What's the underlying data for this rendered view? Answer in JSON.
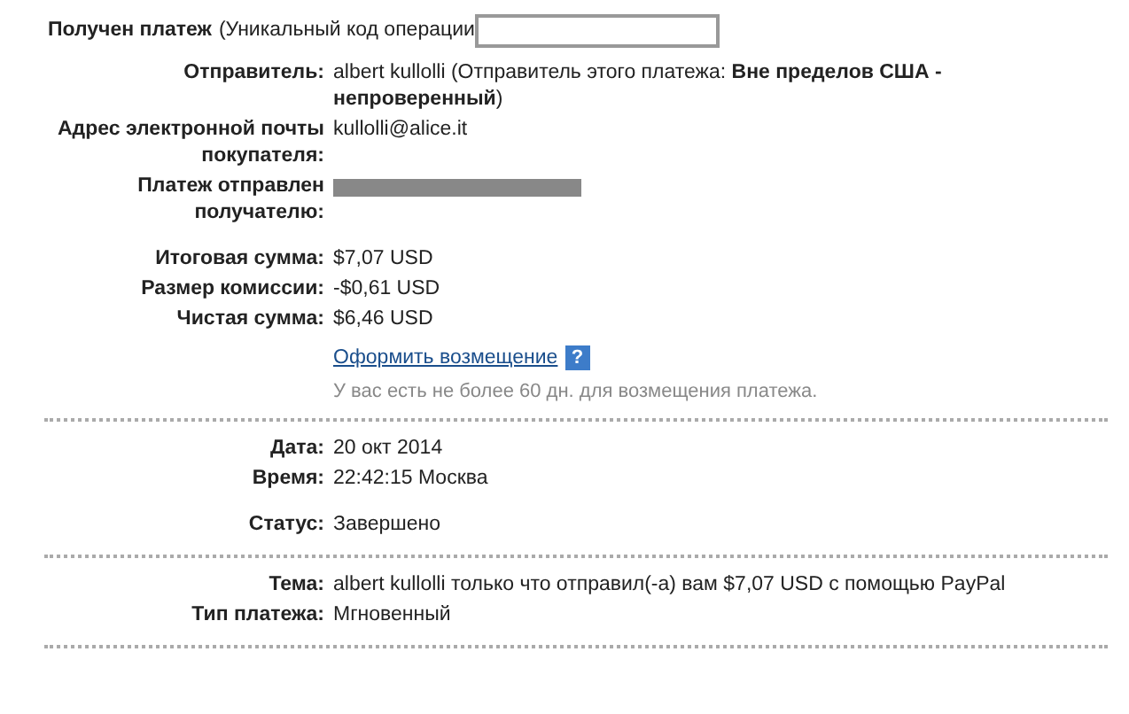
{
  "header": {
    "title": "Получен платеж",
    "text": "(Уникальный код операции",
    "code_redacted": true
  },
  "sections": [
    {
      "groups": [
        [
          {
            "kind": "text",
            "label": "Отправитель:",
            "value": "albert kullolli (Отправитель этого платежа: **Вне пределов США - непроверенный**)"
          },
          {
            "kind": "text",
            "label": "Адрес электронной почты покупателя:",
            "value": "kullolli@alice.it"
          },
          {
            "kind": "redacted",
            "label": "Платеж отправлен получателю:"
          }
        ],
        [
          {
            "kind": "text",
            "label": "Итоговая сумма:",
            "value": "$7,07 USD"
          },
          {
            "kind": "text",
            "label": "Размер комиссии:",
            "value": "-$0,61 USD"
          },
          {
            "kind": "text",
            "label": "Чистая сумма:",
            "value": "$6,46 USD"
          }
        ]
      ],
      "refund": {
        "link": "Оформить возмещение",
        "help": "?",
        "note": "У вас есть не более 60 дн. для возмещения платежа."
      }
    },
    {
      "groups": [
        [
          {
            "kind": "text",
            "label": "Дата:",
            "value": "20 окт 2014"
          },
          {
            "kind": "text",
            "label": "Время:",
            "value": "22:42:15 Москва"
          }
        ],
        [
          {
            "kind": "text",
            "label": "Статус:",
            "value": "Завершено"
          }
        ]
      ]
    },
    {
      "groups": [
        [
          {
            "kind": "text",
            "label": "Тема:",
            "value": "albert kullolli только что отправил(-а) вам $7,07 USD с помощью PayPal"
          },
          {
            "kind": "text",
            "label": "Тип платежа:",
            "value": "Мгновенный"
          }
        ]
      ]
    }
  ]
}
